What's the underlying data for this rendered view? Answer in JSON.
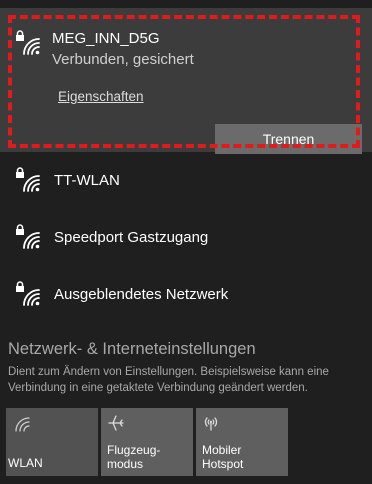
{
  "connected_network": {
    "name": "MEG_INN_D5G",
    "status": "Verbunden, gesichert",
    "properties_link": "Eigenschaften",
    "disconnect_label": "Trennen"
  },
  "networks": [
    {
      "name": "TT-WLAN",
      "icon": "secured-wifi-icon"
    },
    {
      "name": "Speedport Gastzugang",
      "icon": "secured-wifi-icon"
    },
    {
      "name": "Ausgeblendetes Netzwerk",
      "icon": "secured-wifi-icon"
    }
  ],
  "settings": {
    "title": "Netzwerk- & Interneteinstellungen",
    "description": "Dient zum Ändern von Einstellungen. Beispielsweise kann eine Verbindung in eine getaktete Verbindung geändert werden."
  },
  "quick_actions": [
    {
      "label": "WLAN",
      "icon": "wifi-icon"
    },
    {
      "label": "Flugzeug-\nmodus",
      "icon": "airplane-icon"
    },
    {
      "label": "Mobiler\nHotspot",
      "icon": "hotspot-icon"
    }
  ],
  "colors": {
    "panel_bg": "#1f1f1f",
    "selected_bg": "#3c3c3c",
    "highlight_border": "#e01b1b",
    "button_bg": "#6b6b6b",
    "tile_bg": "#5f5f5f"
  }
}
